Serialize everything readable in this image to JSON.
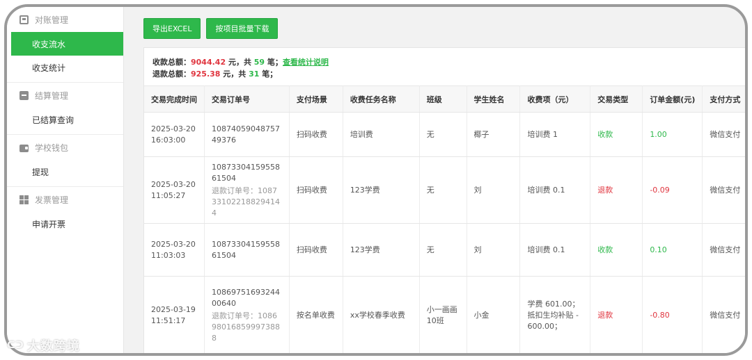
{
  "sidebar": {
    "groups": [
      {
        "title": "对账管理",
        "items": [
          "收支流水",
          "收支统计"
        ]
      },
      {
        "title": "结算管理",
        "items": [
          "已结算查询"
        ]
      },
      {
        "title": "学校钱包",
        "items": [
          "提现"
        ]
      },
      {
        "title": "发票管理",
        "items": [
          "申请开票"
        ]
      }
    ],
    "active_item": "收支流水"
  },
  "toolbar": {
    "export_label": "导出EXCEL",
    "batch_download_label": "按项目批量下载"
  },
  "summary": {
    "income_label": "收款总额：",
    "income_amount": "9044.42",
    "income_unit": " 元，共 ",
    "income_count": "59",
    "income_count_unit": " 笔；",
    "stats_link": "查看统计说明",
    "refund_label": "退款总额：",
    "refund_amount": "925.38",
    "refund_unit": " 元，共 ",
    "refund_count": "31",
    "refund_count_unit": " 笔；"
  },
  "table": {
    "headers": [
      "交易完成时间",
      "交易订单号",
      "支付场景",
      "收费任务名称",
      "班级",
      "学生姓名",
      "收费项（元）",
      "交易类型",
      "订单金额(元)",
      "支付方式"
    ],
    "rows": [
      {
        "time": "2025-03-20 16:03:00",
        "order": "1087405904875749376",
        "refund_order": "",
        "scene": "扫码收费",
        "task": "培训费",
        "class": "无",
        "student": "椰子",
        "fee_item": "培训费 1",
        "type": "收款",
        "amount": "1.00",
        "pay": "微信支付"
      },
      {
        "time": "2025-03-20 11:05:27",
        "order": "1087330415955861504",
        "refund_order": "退款订单号：1087331022188294144",
        "scene": "扫码收费",
        "task": "123学费",
        "class": "无",
        "student": "刘",
        "fee_item": "培训费 0.1",
        "type": "退款",
        "amount": "-0.09",
        "pay": "微信支付"
      },
      {
        "time": "2025-03-20 11:03:03",
        "order": "1087330415955861504",
        "refund_order": "",
        "scene": "扫码收费",
        "task": "123学费",
        "class": "无",
        "student": "刘",
        "fee_item": "培训费 0.1",
        "type": "收款",
        "amount": "0.10",
        "pay": "微信支付"
      },
      {
        "time": "2025-03-19 11:51:17",
        "order": "1086975169324400640",
        "refund_order": "退款订单号：1086980168599973888",
        "scene": "按名单收费",
        "task": "xx学校春季收费",
        "class": "小一画画10班",
        "student": "小金",
        "fee_item": "学费 601.00；抵扣生均补贴 -600.00；",
        "type": "退款",
        "amount": "-0.80",
        "pay": "微信支付"
      }
    ]
  },
  "watermark": {
    "text": "大数跨境"
  },
  "colors": {
    "accent": "#2eb84b",
    "danger": "#e0353f"
  }
}
